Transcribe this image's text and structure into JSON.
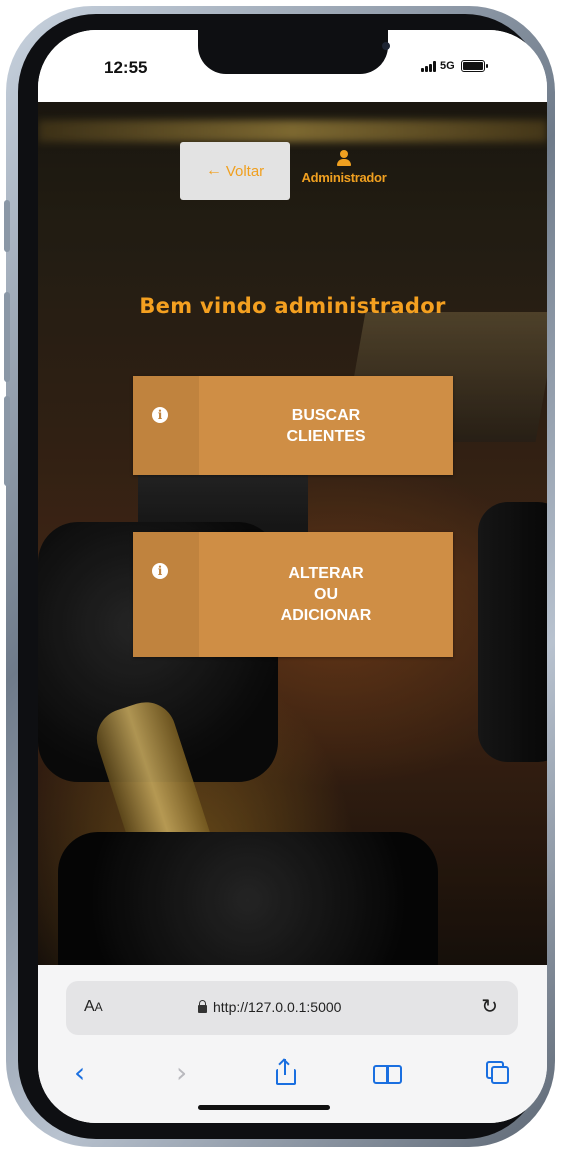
{
  "status_bar": {
    "time": "12:55",
    "network": "5G",
    "icons": [
      "signal-icon",
      "battery-icon"
    ]
  },
  "header": {
    "back_label": "Voltar",
    "back_icon": "arrow-left-icon",
    "user_label": "Administrador",
    "user_icon": "user-icon"
  },
  "main": {
    "title": "Bem vindo administrador",
    "buttons": [
      {
        "label": "BUSCAR CLIENTES",
        "icon": "info-icon"
      },
      {
        "label": "ALTERAR OU ADICIONAR",
        "icon": "info-icon"
      }
    ]
  },
  "browser": {
    "text_size_label": "AA",
    "url": "http://127.0.0.1:5000",
    "toolbar_icons": [
      "back-icon",
      "forward-icon",
      "share-icon",
      "bookmarks-icon",
      "tabs-icon"
    ]
  },
  "colors": {
    "accent": "#f4a020",
    "button_fill": "#cf8e45",
    "button_icon_fill": "#c0833e",
    "link_blue": "#1a6fe0"
  }
}
